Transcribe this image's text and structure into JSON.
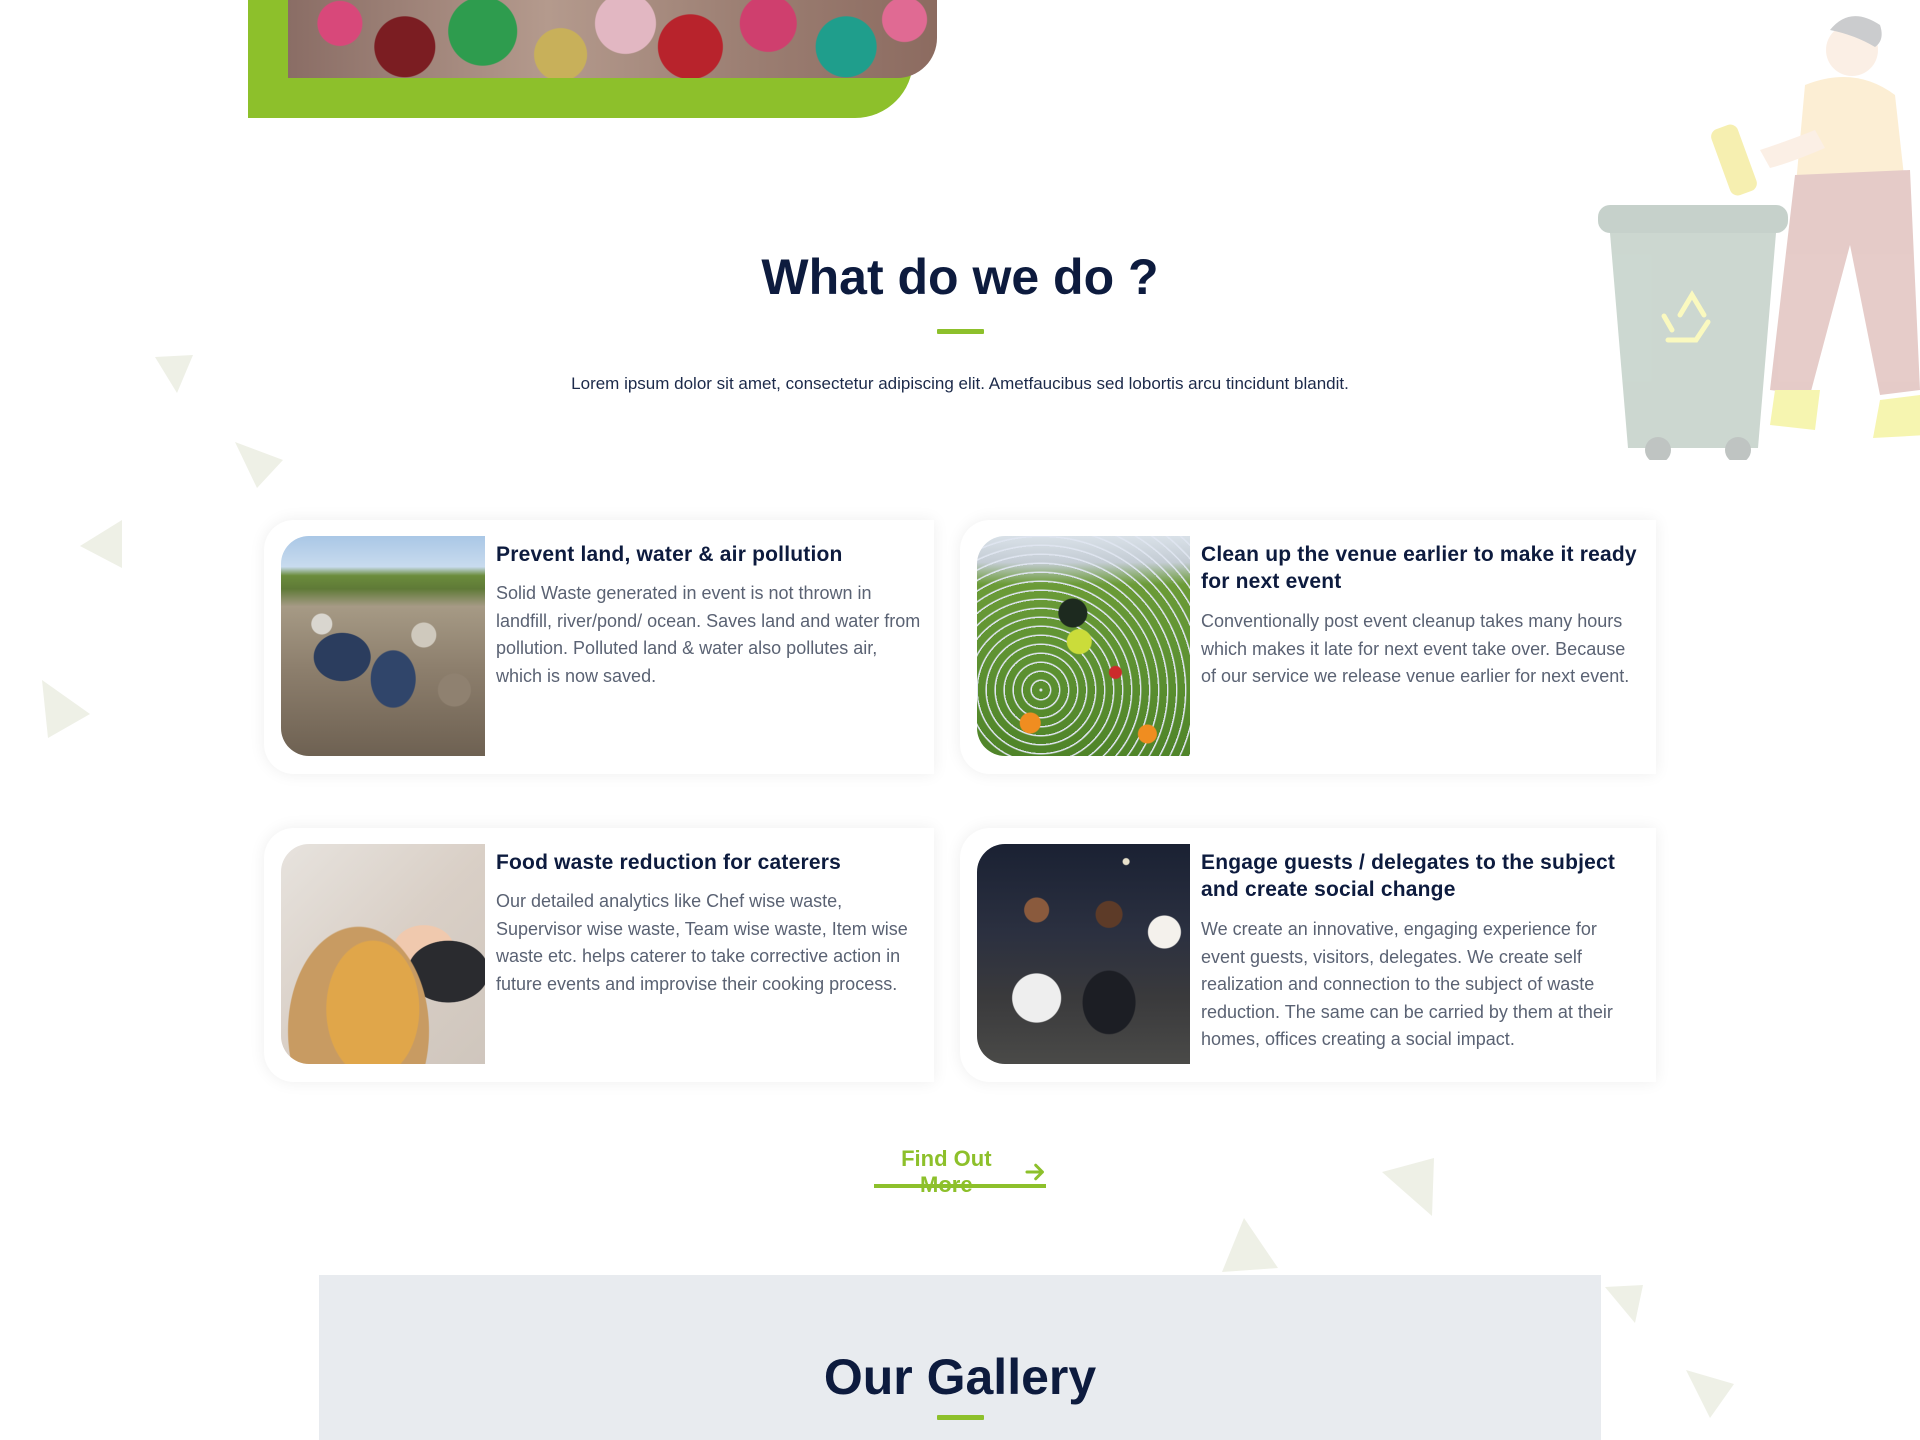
{
  "banner": {
    "alt": ""
  },
  "what_we_do": {
    "title": "What do we do ?",
    "intro": "Lorem ipsum dolor sit amet, consectetur adipiscing elit. Ametfaucibus sed lobortis arcu tincidunt blandit."
  },
  "services": [
    {
      "title": "Prevent land, water & air pollution",
      "description": "Solid Waste generated in event is not thrown in landfill, river/pond/ ocean. Saves land and water from pollution. Polluted land & water also pollutes air, which is now saved."
    },
    {
      "title": "Clean up the venue earlier to make it ready for next event",
      "description": "Conventionally post event cleanup takes many hours which makes it late for next event take over. Because of our service we release venue earlier for next event."
    },
    {
      "title": "Food waste reduction for caterers",
      "description": "Our detailed analytics like Chef wise waste, Supervisor wise waste, Team wise waste, Item wise waste etc. helps caterer to take corrective action in future events and improvise their cooking process."
    },
    {
      "title": "Engage guests / delegates to the subject and create social change",
      "description": "We create an innovative, engaging experience for event guests, visitors, delegates. We create self realization and connection to the subject of waste reduction. The same can be carried by them at their homes, offices creating a social impact."
    }
  ],
  "cta": {
    "label": "Find Out More",
    "icon": "arrow-right-icon"
  },
  "gallery": {
    "title": "Our Gallery"
  },
  "colors": {
    "accent": "#8dc02b",
    "heading": "#0d1b3e",
    "body_text": "#5a6273",
    "gallery_bg": "#e8ebef"
  }
}
